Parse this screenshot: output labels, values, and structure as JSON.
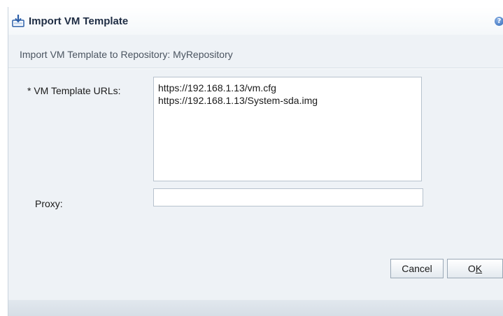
{
  "dialog": {
    "title": "Import VM Template",
    "help_icon": "help-icon",
    "help_glyph": "?",
    "title_icon": "import-icon"
  },
  "subtitle": "Import VM Template to Repository: MyRepository",
  "form": {
    "urls": {
      "required_marker": "*",
      "label": "VM Template URLs:",
      "value": "https://192.168.1.13/vm.cfg\nhttps://192.168.1.13/System-sda.img"
    },
    "proxy": {
      "label": "Proxy:",
      "value": ""
    }
  },
  "buttons": {
    "cancel_label": "Cancel",
    "ok_label": "OK"
  },
  "colors": {
    "dialog_bg": "#eef2f6",
    "title_text": "#1f2d44",
    "help_icon": "#2d66b8"
  }
}
